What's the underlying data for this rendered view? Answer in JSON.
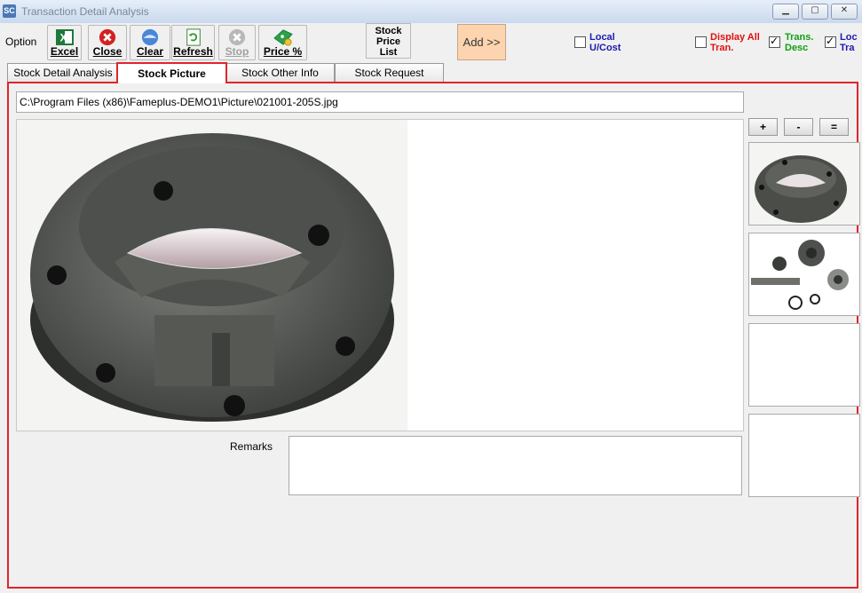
{
  "window": {
    "title": "Transaction Detail Analysis",
    "icon_text": "SC"
  },
  "toolbar": {
    "option_label": "Option",
    "buttons": [
      {
        "label": "Excel",
        "icon": "excel-icon"
      },
      {
        "label": "Close",
        "icon": "close-icon"
      },
      {
        "label": "Clear",
        "icon": "clear-icon"
      },
      {
        "label": "Refresh",
        "icon": "refresh-icon"
      },
      {
        "label": "Stop",
        "icon": "stop-icon",
        "disabled": true
      },
      {
        "label": "Price %",
        "icon": "price-icon"
      }
    ],
    "stock_price_list": "Stock Price List",
    "add_label": "Add >>",
    "checkboxes": [
      {
        "label": "Local U/Cost",
        "checked": false,
        "color": "#1b1bb0"
      },
      {
        "label": "Display All Tran.",
        "checked": false,
        "color": "#e01010"
      },
      {
        "label": "Trans. Desc",
        "checked": true,
        "color": "#10a010"
      },
      {
        "label": "Loc Tra",
        "checked": true,
        "color": "#1b1bb0"
      }
    ]
  },
  "tabs": [
    {
      "label": "Stock Detail Analysis",
      "active": false
    },
    {
      "label": "Stock Picture",
      "active": true
    },
    {
      "label": "Stock Other Info",
      "active": false
    },
    {
      "label": "Stock Request",
      "active": false
    }
  ],
  "picture": {
    "path": "C:\\Program Files (x86)\\Fameplus-DEMO1\\Picture\\021001-205S.jpg",
    "zoom_buttons": [
      "+",
      "-",
      "="
    ]
  },
  "remarks": {
    "label": "Remarks",
    "value": ""
  },
  "colors": {
    "accent_border": "#e0252b",
    "add_button": "#fcd5b0"
  }
}
